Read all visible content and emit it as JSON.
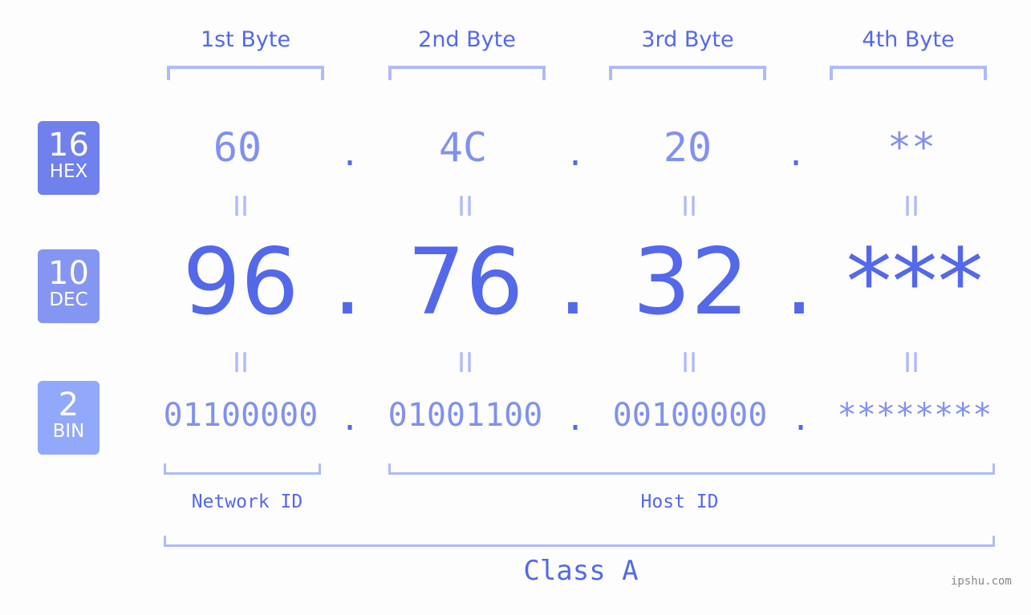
{
  "byte_headers": [
    "1st Byte",
    "2nd Byte",
    "3rd Byte",
    "4th Byte"
  ],
  "bases": [
    {
      "num": "16",
      "label": "HEX",
      "color": "#7080ec"
    },
    {
      "num": "10",
      "label": "DEC",
      "color": "#8595f2"
    },
    {
      "num": "2",
      "label": "BIN",
      "color": "#91a8fb"
    }
  ],
  "hex": [
    "60",
    "4C",
    "20",
    "**"
  ],
  "dec": [
    "96",
    "76",
    "32",
    "***"
  ],
  "bin": [
    "01100000",
    "01001100",
    "00100000",
    "********"
  ],
  "separator": ".",
  "equals": "II",
  "segments": {
    "network": "Network ID",
    "host": "Host ID"
  },
  "class_label": "Class A",
  "watermark": "ipshu.com",
  "colors": {
    "primary": "#5468ea",
    "light": "#8091ee",
    "bracket": "#b0baf8"
  }
}
